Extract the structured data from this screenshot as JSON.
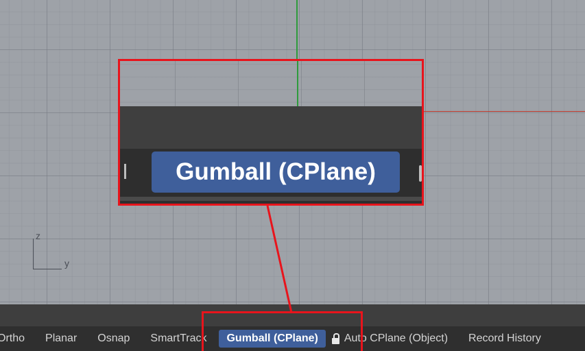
{
  "viewport": {
    "axis_labels": {
      "z": "z",
      "y": "y"
    },
    "axis_colors": {
      "x": "#c0392b",
      "y": "#2e9b3c"
    }
  },
  "status_bar": {
    "items": [
      {
        "label": "Ortho"
      },
      {
        "label": "Planar"
      },
      {
        "label": "Osnap"
      },
      {
        "label": "SmartTrack"
      },
      {
        "label": "Gumball (CPlane)",
        "active": true
      },
      {
        "label": "Auto CPlane (Object)"
      },
      {
        "label": "Record History"
      }
    ],
    "lock_icon": "lock-icon"
  },
  "zoom_callout": {
    "label": "Gumball (CPlane)",
    "highlight_color": "#e8141c"
  },
  "colors": {
    "active_pill": "#3f5f9b",
    "status_bg": "#2f2f2f",
    "viewport_bg": "#9ea2a8"
  }
}
